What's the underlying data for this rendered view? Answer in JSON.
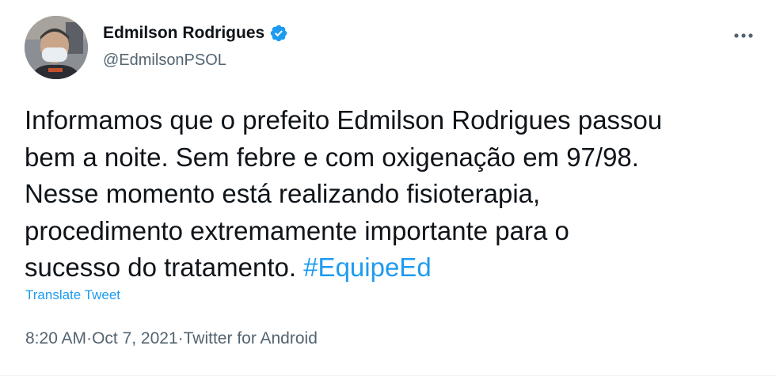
{
  "author": {
    "name": "Edmilson Rodrigues",
    "handle": "@EdmilsonPSOL",
    "verified": true
  },
  "icons": {
    "verified": "verified-badge-icon",
    "more": "more-horizontal-icon",
    "avatar": "profile-photo"
  },
  "colors": {
    "text": "#0f1419",
    "secondary": "#536471",
    "accent": "#1d9bf0"
  },
  "tweet": {
    "text_line1": "Informamos que o prefeito Edmilson Rodrigues passou",
    "text_line2": "bem a noite. Sem febre e com oxigenação em 97/98.",
    "text_line3": "Nesse momento está realizando fisioterapia,",
    "text_line4": "procedimento extremamente importante para o",
    "text_line5_prefix": "sucesso do tratamento. ",
    "hashtag": "#EquipeEd",
    "translate_label": "Translate Tweet",
    "time": "8:20 AM",
    "separator": " · ",
    "date": "Oct 7, 2021",
    "source": "Twitter for Android"
  }
}
